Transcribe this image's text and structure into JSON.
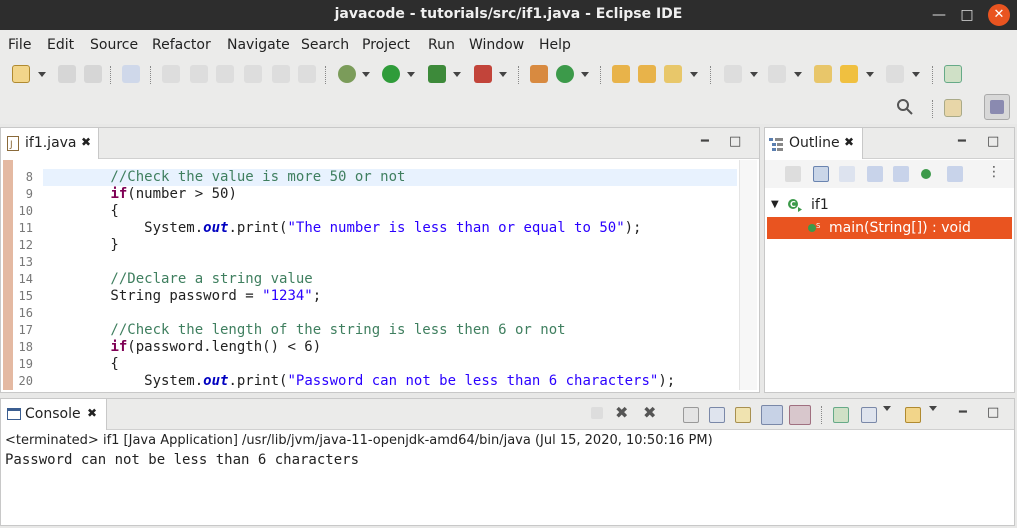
{
  "window": {
    "title": "javacode - tutorials/src/if1.java - Eclipse IDE"
  },
  "menu": [
    "File",
    "Edit",
    "Source",
    "Refactor",
    "Navigate",
    "Search",
    "Project",
    "Run",
    "Window",
    "Help"
  ],
  "editor": {
    "tab_label": "if1.java",
    "lines": [
      {
        "num": "8",
        "text": "        //Check the value is more 50 or not"
      },
      {
        "num": "9",
        "text": "        if(number > 50)"
      },
      {
        "num": "10",
        "text": "        {"
      },
      {
        "num": "11",
        "text": "            System.out.print(\"The number is less than or equal to 50\");"
      },
      {
        "num": "12",
        "text": "        }"
      },
      {
        "num": "13",
        "text": ""
      },
      {
        "num": "14",
        "text": "        //Declare a string value"
      },
      {
        "num": "15",
        "text": "        String password = \"1234\";"
      },
      {
        "num": "16",
        "text": ""
      },
      {
        "num": "17",
        "text": "        //Check the length of the string is less then 6 or not"
      },
      {
        "num": "18",
        "text": "        if(password.length() < 6)"
      },
      {
        "num": "19",
        "text": "        {"
      },
      {
        "num": "20",
        "text": "            System.out.print(\"Password can not be less than 6 characters\");"
      }
    ]
  },
  "outline": {
    "tab_label": "Outline",
    "class_name": "if1",
    "method": "main(String[]) : void"
  },
  "console": {
    "tab_label": "Console",
    "status": "<terminated> if1 [Java Application] /usr/lib/jvm/java-11-openjdk-amd64/bin/java (Jul 15, 2020, 10:50:16 PM)",
    "output": "Password can not be less than 6 characters"
  },
  "colors": {
    "accent": "#e95420",
    "titlebar": "#2d2d2d",
    "comment": "#3f7f5f",
    "keyword": "#7f0055",
    "string": "#2a00ff"
  },
  "icons": [
    "new-icon",
    "save-icon",
    "debug-icon",
    "run-icon",
    "search-icon",
    "perspective-icon",
    "close-icon",
    "minimize-icon",
    "maximize-icon"
  ]
}
